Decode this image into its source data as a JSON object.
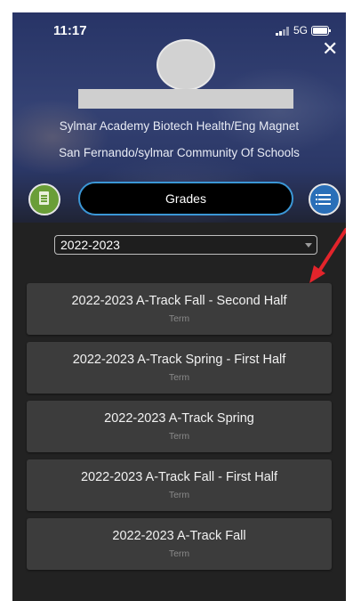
{
  "status_bar": {
    "time": "11:17",
    "network": "5G"
  },
  "profile": {
    "school": "Sylmar Academy Biotech Health/Eng Magnet",
    "community": "San Fernando/sylmar Community Of Schools"
  },
  "icons": {
    "close": "close-icon",
    "left": "document-icon",
    "right": "list-icon"
  },
  "nav": {
    "grades_label": "Grades"
  },
  "year_select": {
    "selected": "2022-2023"
  },
  "terms": [
    {
      "title": "2022-2023 A-Track Fall - Second Half",
      "subtitle": "Term"
    },
    {
      "title": "2022-2023 A-Track Spring - First Half",
      "subtitle": "Term"
    },
    {
      "title": "2022-2023 A-Track Spring",
      "subtitle": "Term"
    },
    {
      "title": "2022-2023 A-Track Fall - First Half",
      "subtitle": "Term"
    },
    {
      "title": "2022-2023 A-Track Fall",
      "subtitle": "Term"
    }
  ],
  "colors": {
    "accent": "#3b97d6",
    "arrow": "#e3242b",
    "card": "#3c3c3c",
    "background": "#222222"
  }
}
